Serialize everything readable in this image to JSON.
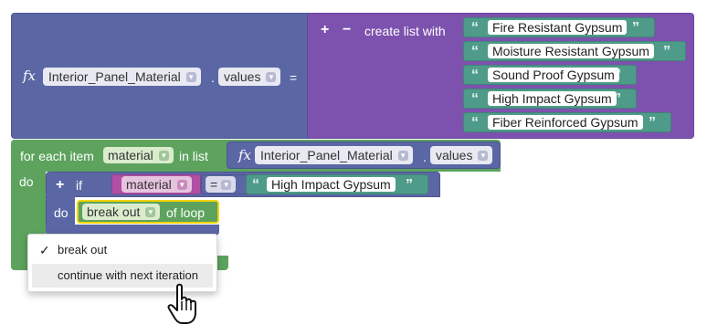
{
  "set_block": {
    "fx_label": "fx",
    "component": "Interior_Panel_Material",
    "property": "values",
    "dot": ".",
    "equals": "="
  },
  "list_block": {
    "plus": "+",
    "minus": "−",
    "label": "create list with",
    "quote_open": "“",
    "quote_close": "”",
    "items": [
      "Fire Resistant Gypsum",
      "Moisture Resistant Gypsum",
      "Sound Proof Gypsum",
      "High Impact Gypsum",
      "Fiber Reinforced Gypsum"
    ]
  },
  "for_each": {
    "label": "for each item",
    "variable": "material",
    "in_list": "in list",
    "do_label": "do",
    "list_component": "Interior_Panel_Material",
    "list_property": "values"
  },
  "if_block": {
    "plus": "+",
    "label": "if",
    "do_label": "do",
    "left_var": "material",
    "operator": "=",
    "compare_value": "High Impact Gypsum"
  },
  "break_block": {
    "selected": "break out",
    "suffix": "of loop"
  },
  "dropdown": {
    "check": "✓",
    "options": [
      "break out",
      "continue with next iteration"
    ],
    "selected_index": 0,
    "hovered_index": 1
  },
  "colors": {
    "component_block": "#5b67a5",
    "list_block": "#7c52ae",
    "string_block": "#4f9b8a",
    "control_block": "#5da35e",
    "variable_block": "#b14fa5",
    "selection_outline": "#f2d300"
  }
}
